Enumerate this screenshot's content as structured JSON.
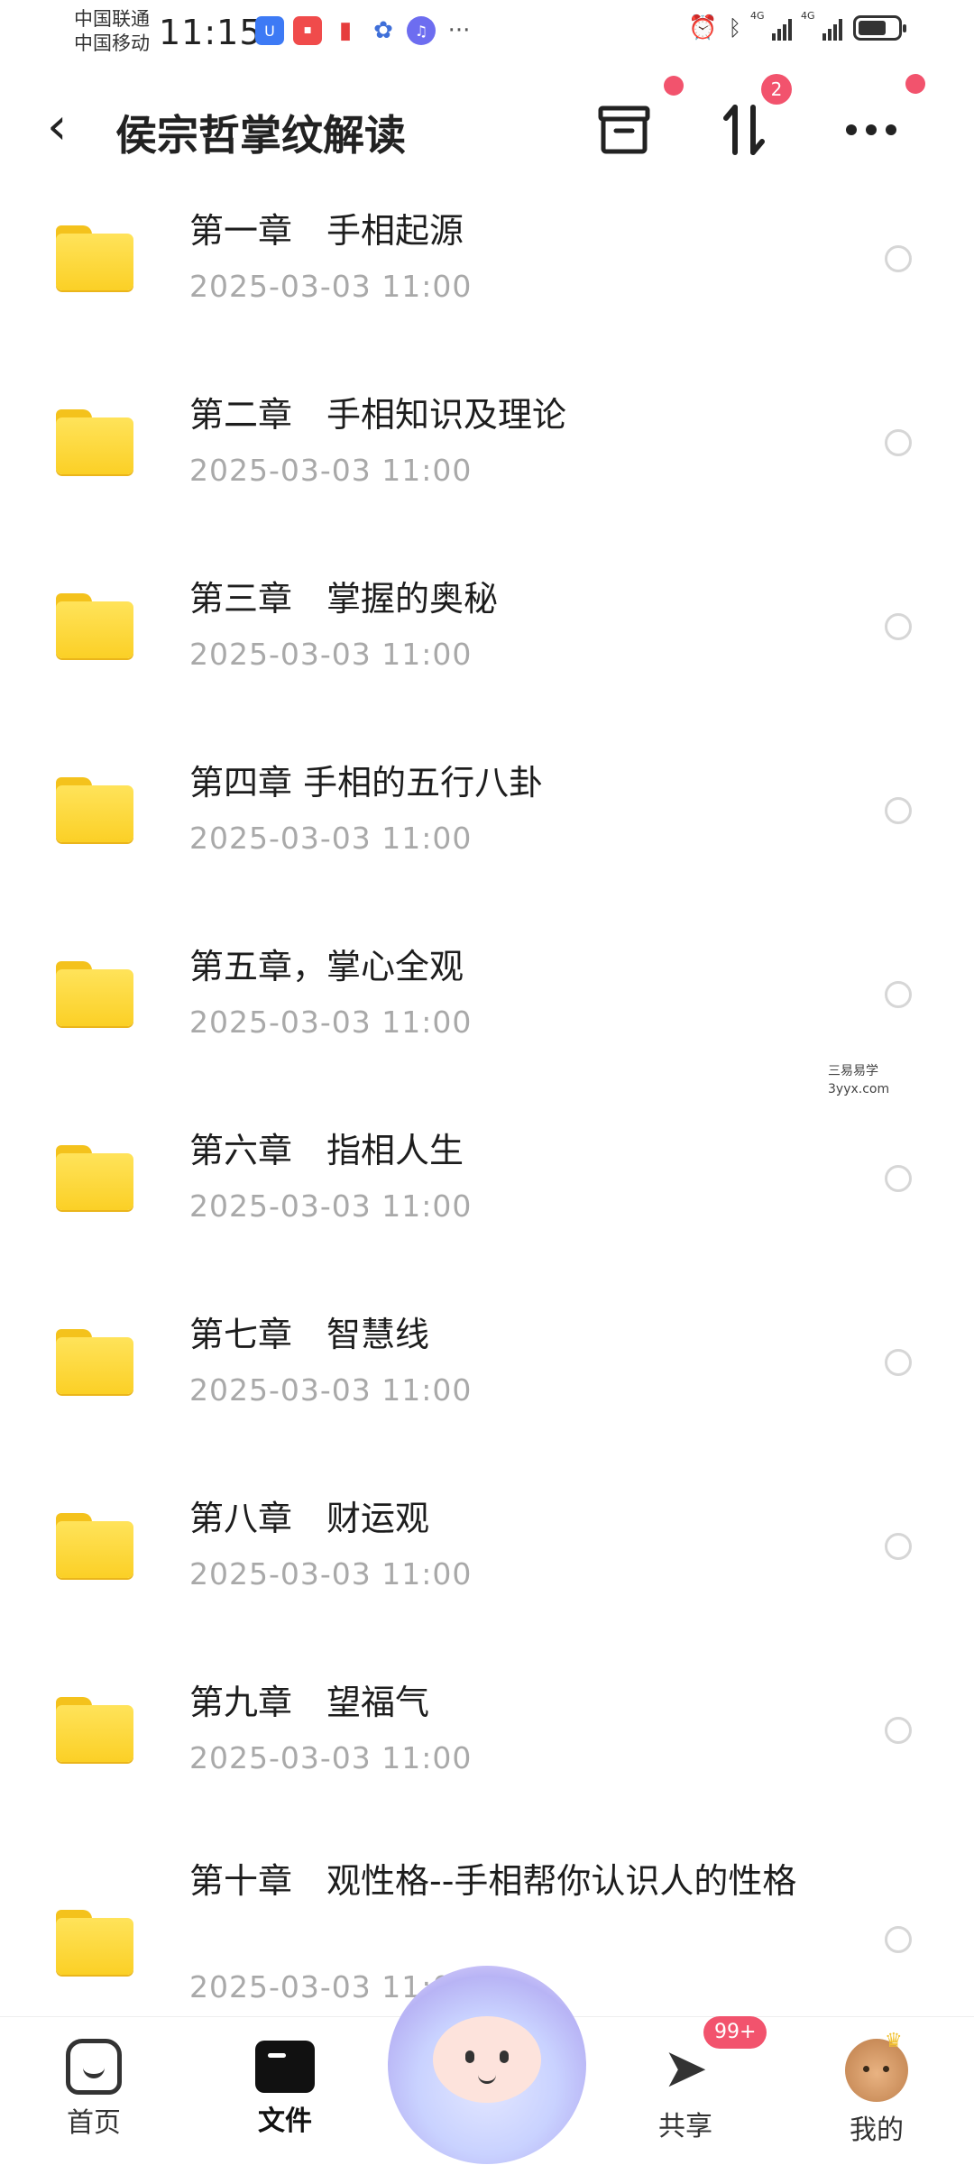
{
  "status_bar": {
    "carrier1": "中国联通",
    "carrier2": "中国移动",
    "time": "11:15",
    "network1": "4G",
    "network2": "4G"
  },
  "header": {
    "title": "侯宗哲掌纹解读",
    "transfer_count": "2"
  },
  "files": [
    {
      "name": "第一章　手相起源",
      "date": "2025-03-03  11:00"
    },
    {
      "name": "第二章　手相知识及理论",
      "date": "2025-03-03  11:00"
    },
    {
      "name": "第三章　掌握的奥秘",
      "date": "2025-03-03  11:00"
    },
    {
      "name": "第四章  手相的五行八卦",
      "date": "2025-03-03  11:00"
    },
    {
      "name": "第五章，掌心全观",
      "date": "2025-03-03  11:00"
    },
    {
      "name": "第六章　指相人生",
      "date": "2025-03-03  11:00"
    },
    {
      "name": "第七章　智慧线",
      "date": "2025-03-03  11:00"
    },
    {
      "name": "第八章　财运观",
      "date": "2025-03-03  11:00"
    },
    {
      "name": "第九章　望福气",
      "date": "2025-03-03  11:00"
    },
    {
      "name": "第十章　观性格--手相帮你认识人的性格",
      "date": "2025-03-03  11:00"
    }
  ],
  "watermark": {
    "line1": "三易易学",
    "line2": "3yyx.com"
  },
  "bottom_nav": {
    "home": "首页",
    "files": "文件",
    "share": "共享",
    "share_badge": "99+",
    "mine": "我的"
  },
  "colors": {
    "folder": "#fbd026",
    "badge": "#f2536d",
    "date_text": "#a9a9a9"
  },
  "icons": [
    "back-icon",
    "archive-icon",
    "sort-icon",
    "more-icon",
    "folder-icon",
    "radio-icon",
    "home-icon",
    "file-icon",
    "send-icon"
  ]
}
